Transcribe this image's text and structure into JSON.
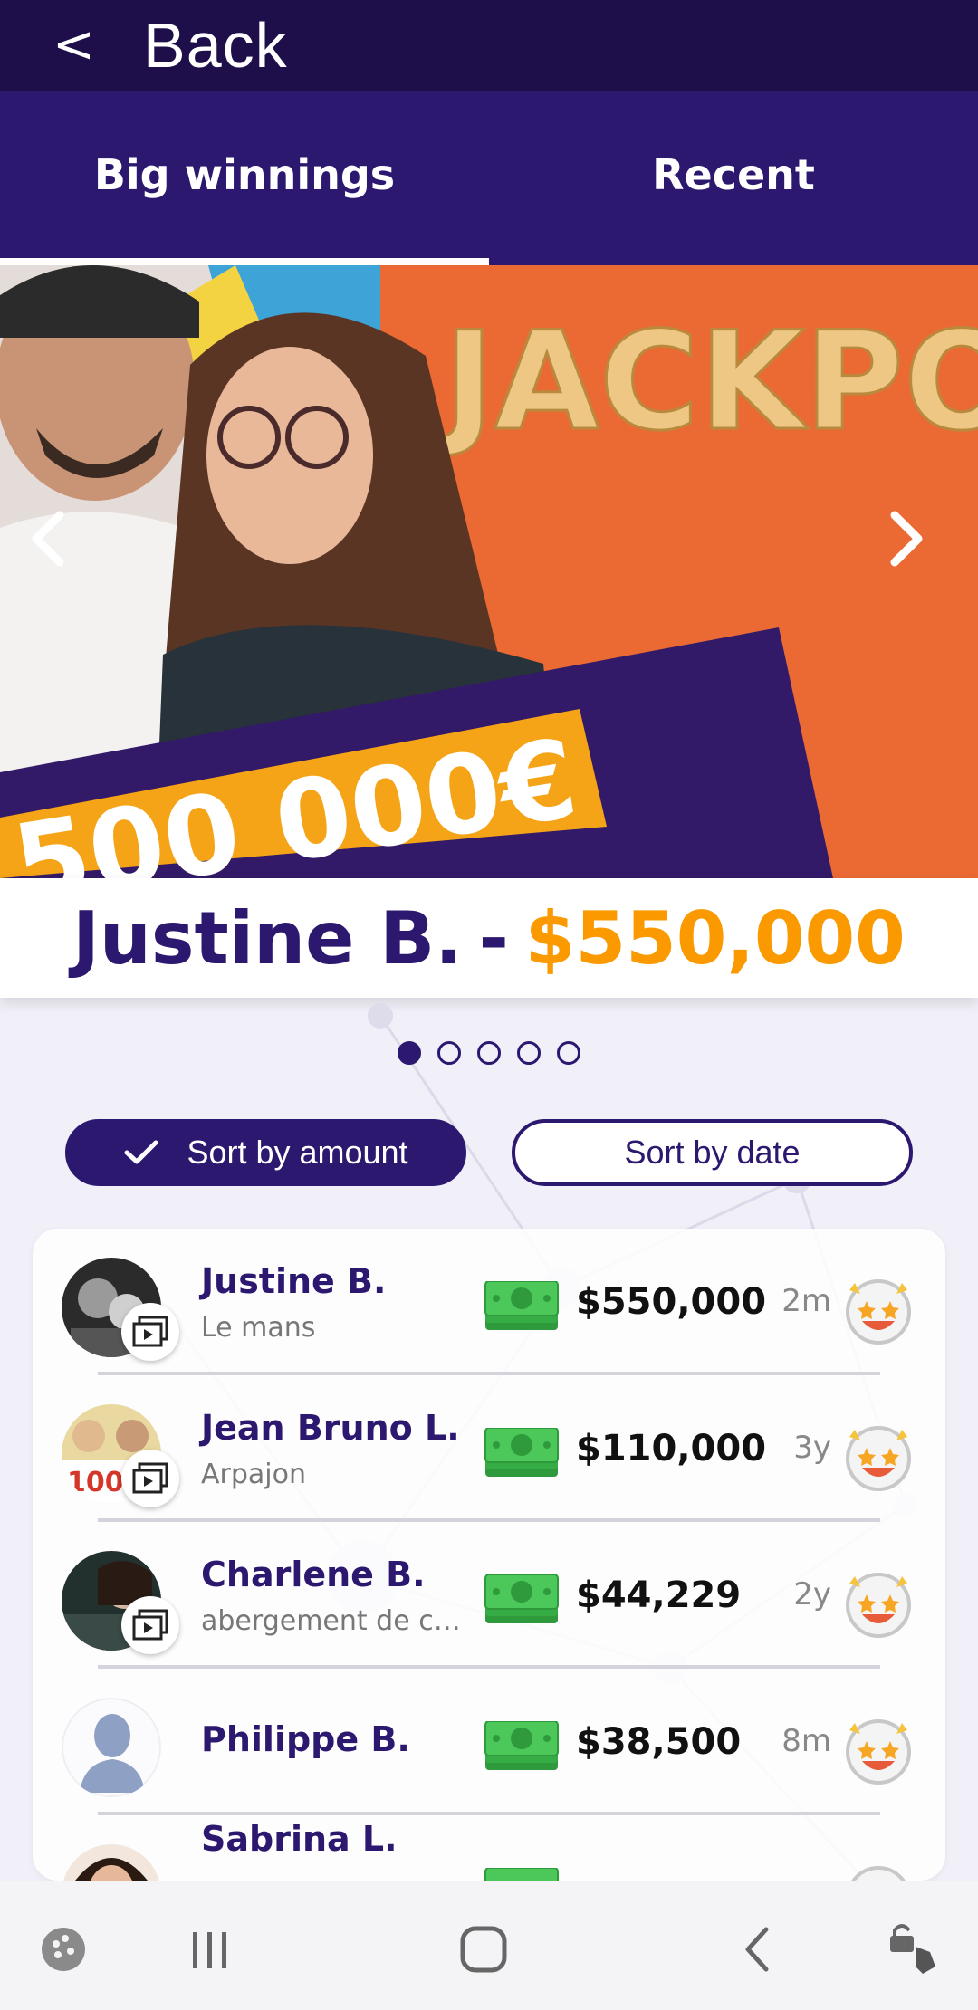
{
  "header": {
    "back_chevron": "<",
    "back_label": "Back"
  },
  "tabs": [
    {
      "label": "Big winnings",
      "active": true
    },
    {
      "label": "Recent",
      "active": false
    }
  ],
  "hero": {
    "name": "Justine B.",
    "separator": "-",
    "amount": "$550,000",
    "photo_texts": {
      "sign": "JACKPOT",
      "cheque": "500 000€"
    }
  },
  "carousel": {
    "count": 5,
    "active_index": 0
  },
  "sort": {
    "amount_label": "Sort by amount",
    "date_label": "Sort by date",
    "selected": "amount"
  },
  "winners": [
    {
      "name": "Justine B.",
      "city": "Le mans",
      "amount": "$550,000",
      "time": "2m",
      "has_video": true
    },
    {
      "name": "Jean Bruno L.",
      "city": "Arpajon",
      "amount": "$110,000",
      "time": "3y",
      "has_video": true
    },
    {
      "name": "Charlene B.",
      "city": "abergement de cui...",
      "amount": "$44,229",
      "time": "2y",
      "has_video": true
    },
    {
      "name": "Philippe B.",
      "city": "",
      "amount": "$38,500",
      "time": "8m",
      "has_video": false
    },
    {
      "name": "Sabrina L.",
      "city": "",
      "amount": "",
      "time": "",
      "has_video": false
    }
  ],
  "colors": {
    "primary": "#2d1870",
    "header": "#1e0f4a",
    "accent": "#fb9a00",
    "money": "#3bb54a"
  },
  "navbar": [
    "game-icon",
    "recent-apps-icon",
    "home-icon",
    "back-icon",
    "accessibility-icon"
  ]
}
